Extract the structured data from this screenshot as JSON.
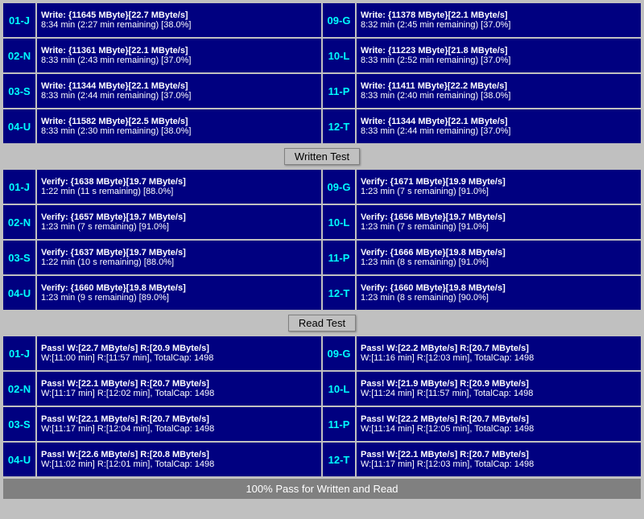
{
  "sections": {
    "write_test": {
      "label": "Written Test",
      "rows": [
        {
          "left_id": "01-J",
          "left_line1": "Write: {11645 MByte}[22.7 MByte/s]",
          "left_line2": "8:34 min (2:27 min remaining)  [38.0%]",
          "right_id": "09-G",
          "right_line1": "Write: {11378 MByte}[22.1 MByte/s]",
          "right_line2": "8:32 min (2:45 min remaining)  [37.0%]"
        },
        {
          "left_id": "02-N",
          "left_line1": "Write: {11361 MByte}[22.1 MByte/s]",
          "left_line2": "8:33 min (2:43 min remaining)  [37.0%]",
          "right_id": "10-L",
          "right_line1": "Write: {11223 MByte}[21.8 MByte/s]",
          "right_line2": "8:33 min (2:52 min remaining)  [37.0%]"
        },
        {
          "left_id": "03-S",
          "left_line1": "Write: {11344 MByte}[22.1 MByte/s]",
          "left_line2": "8:33 min (2:44 min remaining)  [37.0%]",
          "right_id": "11-P",
          "right_line1": "Write: {11411 MByte}[22.2 MByte/s]",
          "right_line2": "8:33 min (2:40 min remaining)  [38.0%]"
        },
        {
          "left_id": "04-U",
          "left_line1": "Write: {11582 MByte}[22.5 MByte/s]",
          "left_line2": "8:33 min (2:30 min remaining)  [38.0%]",
          "right_id": "12-T",
          "right_line1": "Write: {11344 MByte}[22.1 MByte/s]",
          "right_line2": "8:33 min (2:44 min remaining)  [37.0%]"
        }
      ]
    },
    "verify_test": {
      "label": "Written Test",
      "rows": [
        {
          "left_id": "01-J",
          "left_line1": "Verify: {1638 MByte}[19.7 MByte/s]",
          "left_line2": "1:22 min (11 s remaining)  [88.0%]",
          "right_id": "09-G",
          "right_line1": "Verify: {1671 MByte}[19.9 MByte/s]",
          "right_line2": "1:23 min (7 s remaining)  [91.0%]"
        },
        {
          "left_id": "02-N",
          "left_line1": "Verify: {1657 MByte}[19.7 MByte/s]",
          "left_line2": "1:23 min (7 s remaining)  [91.0%]",
          "right_id": "10-L",
          "right_line1": "Verify: {1656 MByte}[19.7 MByte/s]",
          "right_line2": "1:23 min (7 s remaining)  [91.0%]"
        },
        {
          "left_id": "03-S",
          "left_line1": "Verify: {1637 MByte}[19.7 MByte/s]",
          "left_line2": "1:22 min (10 s remaining)  [88.0%]",
          "right_id": "11-P",
          "right_line1": "Verify: {1666 MByte}[19.8 MByte/s]",
          "right_line2": "1:23 min (8 s remaining)  [91.0%]"
        },
        {
          "left_id": "04-U",
          "left_line1": "Verify: {1660 MByte}[19.8 MByte/s]",
          "left_line2": "1:23 min (9 s remaining)  [89.0%]",
          "right_id": "12-T",
          "right_line1": "Verify: {1660 MByte}[19.8 MByte/s]",
          "right_line2": "1:23 min (8 s remaining)  [90.0%]"
        }
      ]
    },
    "read_test": {
      "label": "Read Test",
      "rows": [
        {
          "left_id": "01-J",
          "left_line1": "Pass! W:[22.7 MByte/s] R:[20.9 MByte/s]",
          "left_line2": "W:[11:00 min] R:[11:57 min], TotalCap: 1498",
          "right_id": "09-G",
          "right_line1": "Pass! W:[22.2 MByte/s] R:[20.7 MByte/s]",
          "right_line2": "W:[11:16 min] R:[12:03 min], TotalCap: 1498"
        },
        {
          "left_id": "02-N",
          "left_line1": "Pass! W:[22.1 MByte/s] R:[20.7 MByte/s]",
          "left_line2": "W:[11:17 min] R:[12:02 min], TotalCap: 1498",
          "right_id": "10-L",
          "right_line1": "Pass! W:[21.9 MByte/s] R:[20.9 MByte/s]",
          "right_line2": "W:[11:24 min] R:[11:57 min], TotalCap: 1498"
        },
        {
          "left_id": "03-S",
          "left_line1": "Pass! W:[22.1 MByte/s] R:[20.7 MByte/s]",
          "left_line2": "W:[11:17 min] R:[12:04 min], TotalCap: 1498",
          "right_id": "11-P",
          "right_line1": "Pass! W:[22.2 MByte/s] R:[20.7 MByte/s]",
          "right_line2": "W:[11:14 min] R:[12:05 min], TotalCap: 1498"
        },
        {
          "left_id": "04-U",
          "left_line1": "Pass! W:[22.6 MByte/s] R:[20.8 MByte/s]",
          "left_line2": "W:[11:02 min] R:[12:01 min], TotalCap: 1498",
          "right_id": "12-T",
          "right_line1": "Pass! W:[22.1 MByte/s] R:[20.7 MByte/s]",
          "right_line2": "W:[11:17 min] R:[12:03 min], TotalCap: 1498"
        }
      ]
    }
  },
  "bottom_status": "100% Pass for Written and Read",
  "dividers": {
    "written": "Written Test",
    "read": "Read Test"
  }
}
